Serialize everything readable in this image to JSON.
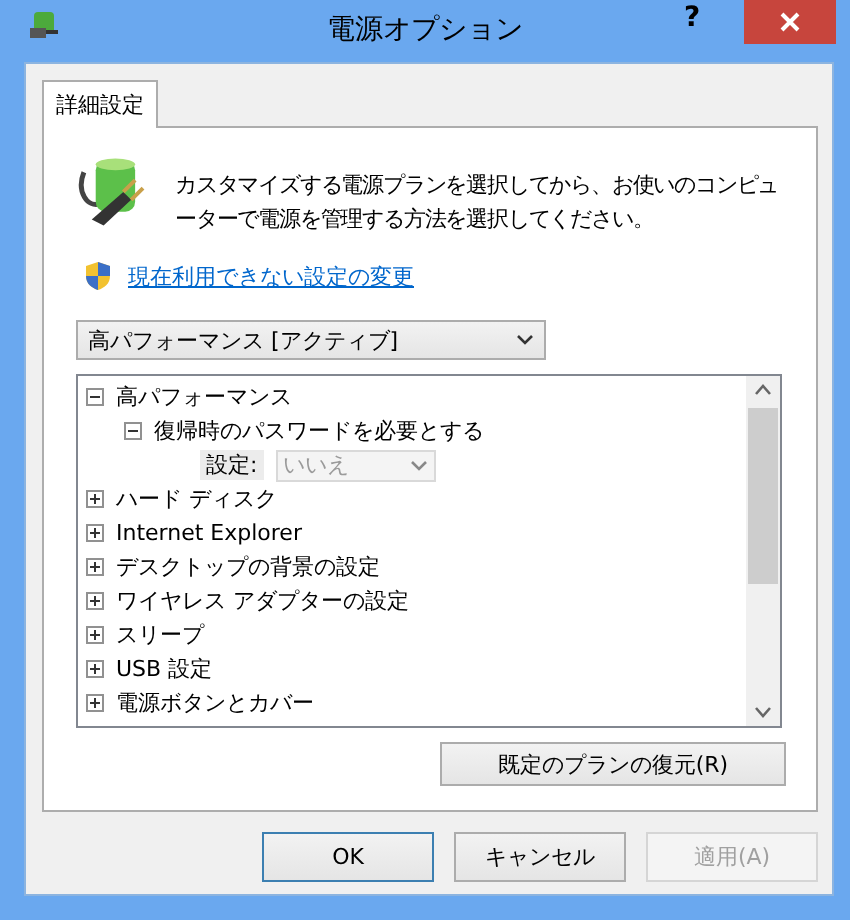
{
  "window": {
    "title": "電源オプション",
    "help": "?"
  },
  "tabs": [
    {
      "label": "詳細設定",
      "selected": true
    }
  ],
  "description": "カスタマイズする電源プランを選択してから、お使いのコンピューターで電源を管理する方法を選択してください。",
  "link": "現在利用できない設定の変更",
  "plan_select": {
    "value": "高パフォーマンス [アクティブ]"
  },
  "tree": [
    {
      "kind": "node",
      "label": "高パフォーマンス",
      "expanded": true,
      "children": [
        {
          "kind": "node",
          "label": "復帰時のパスワードを必要とする",
          "expanded": true,
          "children": [
            {
              "kind": "setting",
              "label": "設定:",
              "value": "いいえ",
              "disabled": true
            }
          ]
        }
      ]
    },
    {
      "kind": "node",
      "label": "ハード ディスク",
      "expanded": false
    },
    {
      "kind": "node",
      "label": "Internet Explorer",
      "expanded": false
    },
    {
      "kind": "node",
      "label": "デスクトップの背景の設定",
      "expanded": false
    },
    {
      "kind": "node",
      "label": "ワイヤレス アダプターの設定",
      "expanded": false
    },
    {
      "kind": "node",
      "label": "スリープ",
      "expanded": false
    },
    {
      "kind": "node",
      "label": "USB 設定",
      "expanded": false
    },
    {
      "kind": "node",
      "label": "電源ボタンとカバー",
      "expanded": false
    }
  ],
  "restore_button": "既定のプランの復元(R)",
  "buttons": [
    {
      "label": "OK",
      "default": true,
      "disabled": false
    },
    {
      "label": "キャンセル",
      "default": false,
      "disabled": false
    },
    {
      "label": "適用(A)",
      "default": false,
      "disabled": true
    }
  ]
}
